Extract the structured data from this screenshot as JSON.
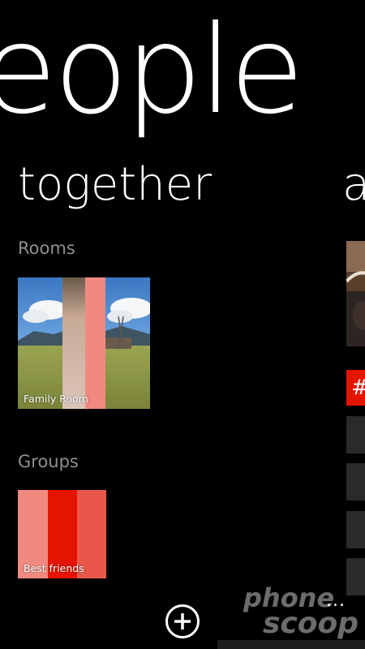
{
  "hub": {
    "title": "eople"
  },
  "pivot": {
    "current": "together",
    "next": "a"
  },
  "rooms": {
    "label": "Rooms",
    "items": [
      {
        "name": "Family Room"
      }
    ]
  },
  "groups": {
    "label": "Groups",
    "items": [
      {
        "name": "Best friends"
      }
    ]
  },
  "side_preview": {
    "hash": "#"
  },
  "appbar": {
    "add_icon": "add-circle-icon",
    "more": "..."
  },
  "watermark": {
    "line1": "phone",
    "line2": "scoop"
  },
  "colors": {
    "background": "#000000",
    "accent_red": "#e51400",
    "salmon": "#f08a80",
    "coral": "#e8574a",
    "label_gray": "#8f8f8f"
  }
}
